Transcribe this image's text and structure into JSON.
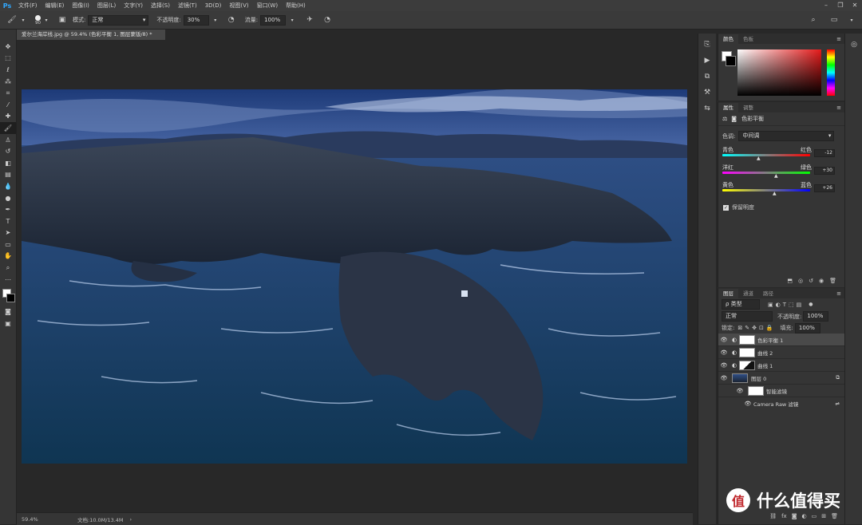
{
  "app": {
    "logo": "Ps"
  },
  "menu": [
    "文件(F)",
    "编辑(E)",
    "图像(I)",
    "图层(L)",
    "文字(Y)",
    "选择(S)",
    "滤镜(T)",
    "3D(D)",
    "视图(V)",
    "窗口(W)",
    "帮助(H)"
  ],
  "options": {
    "brush_size": "90",
    "mode_label": "模式:",
    "mode_value": "正常",
    "opacity_label": "不透明度:",
    "opacity_value": "30%",
    "flow_label": "流量:",
    "flow_value": "100%"
  },
  "document": {
    "tab_title": "爱尔兰海岸线.jpg @ 59.4% (色彩平衡 1, 图层蒙版/8) *"
  },
  "status": {
    "zoom": "59.4%",
    "doc_info": "文档:10.0M/13.4M"
  },
  "color_panel": {
    "tabs": [
      "颜色",
      "色板"
    ]
  },
  "properties_panel": {
    "tabs": [
      "属性",
      "调整"
    ],
    "adjustment_name": "色彩平衡",
    "tone_label": "色调:",
    "tone_value": "中间调",
    "sliders": [
      {
        "left": "青色",
        "right": "红色",
        "value": "-12"
      },
      {
        "left": "洋红",
        "right": "绿色",
        "value": "+30"
      },
      {
        "left": "黄色",
        "right": "蓝色",
        "value": "+26"
      }
    ],
    "preserve_label": "保留明度"
  },
  "layers_panel": {
    "tabs": [
      "图层",
      "通道",
      "路径"
    ],
    "filter_value": "ρ 类型",
    "blend_value": "正常",
    "opacity_label": "不透明度:",
    "opacity_value": "100%",
    "lock_label": "锁定:",
    "fill_label": "填充:",
    "fill_value": "100%",
    "layers": [
      {
        "name": "色彩平衡 1"
      },
      {
        "name": "曲线 2"
      },
      {
        "name": "曲线 1"
      },
      {
        "name": "图层 0"
      },
      {
        "name": "智能滤镜"
      },
      {
        "name": "Camera Raw 滤镜"
      }
    ]
  },
  "watermark": {
    "text": "什么值得买",
    "mark": "值"
  },
  "colors": {
    "accent": "#31a8ff",
    "panel": "#353535",
    "bg": "#282828"
  }
}
